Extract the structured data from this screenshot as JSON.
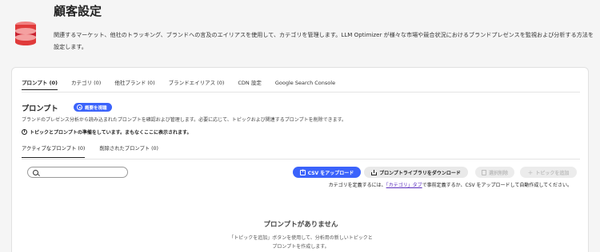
{
  "page": {
    "title": "顧客設定",
    "description": "関連するマーケット、他社のトラッキング、ブランドへの言及のエイリアスを使用して、カテゴリを管理します。LLM Optimizer が様々な市場や競合状況におけるブランドプレゼンスを監視および分析する方法を設定します。"
  },
  "tabs": [
    {
      "label": "プロンプト (0)",
      "active": true
    },
    {
      "label": "カテゴリ (0)",
      "active": false
    },
    {
      "label": "他社ブランド (0)",
      "active": false
    },
    {
      "label": "ブランドエイリアス (0)",
      "active": false
    },
    {
      "label": "CDN 設定",
      "active": false
    },
    {
      "label": "Google Search Console",
      "active": false
    }
  ],
  "section": {
    "title": "プロンプト",
    "overview_button": "概要を視聴",
    "description": "ブランドのプレゼンス分析から読み込まれたプロンプトを確認および管理します。必要に応じて、トピックおよび関連するプロンプトを削除できます。",
    "notice": "トピックとプロンプトの準備をしています。まもなくここに表示されます。"
  },
  "subtabs": [
    {
      "label": "アクティブなプロンプト (0)",
      "active": true
    },
    {
      "label": "削除されたプロンプト (0)",
      "active": false
    }
  ],
  "search": {
    "placeholder": "",
    "value": ""
  },
  "actions": {
    "upload_csv": "CSV をアップロード",
    "download_library": "プロンプトライブラリをダウンロード",
    "delete": "選択削除",
    "add_topic": "トピックを追加"
  },
  "hint": {
    "prefix": "カテゴリを定義するには、",
    "link": "「カテゴリ」タブ",
    "suffix": "で事前定義するか、CSV をアップロードして自動作成してください。"
  },
  "empty_state": {
    "title": "プロンプトがありません",
    "description": "「トピックを追加」ボタンを使用して、分析用の新しいトピックとプロンプトを作成します。"
  },
  "colors": {
    "accent": "#3b63fb",
    "link": "#5a2dbd",
    "background": "#f5f5f5",
    "logo": [
      "#e03a3a",
      "#c8202f",
      "#f08080"
    ]
  },
  "icons": {
    "logo": "stacked-database-logo",
    "overview": "play-circle-icon",
    "notice": "info-icon",
    "search": "search-icon",
    "upload": "upload-icon",
    "download": "download-icon",
    "delete": "trash-icon",
    "add": "plus-icon"
  }
}
